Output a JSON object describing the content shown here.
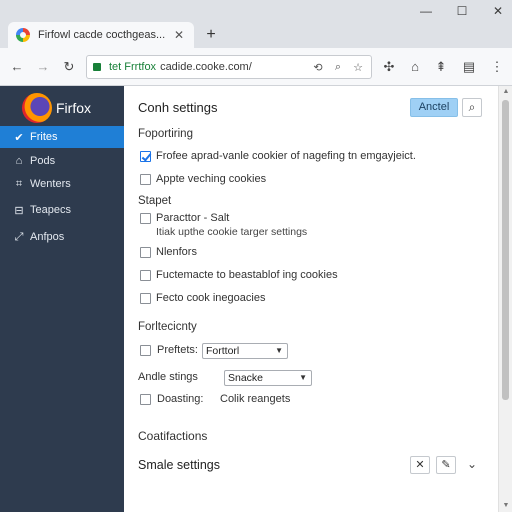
{
  "window": {
    "minimize": "—",
    "maximize": "☐",
    "close": "✕"
  },
  "tab": {
    "title": "Firfowl cacde cocthgeas...",
    "close": "✕",
    "new_tab": "+"
  },
  "toolbar": {
    "back": "←",
    "forward": "→",
    "reload": "↻",
    "url_prefix": "tet Frrtfox",
    "url": "cadide.cooke.com/",
    "url_icons": [
      "⟲",
      "⌕",
      "☆"
    ],
    "right_icons": [
      "✣",
      "⌂",
      "⇞",
      "▤",
      "⋮"
    ]
  },
  "sidebar": {
    "brand": "Firfox",
    "items": [
      {
        "label": "Frites",
        "icon": "✔",
        "active": true
      },
      {
        "label": "Pods",
        "icon": "⌂",
        "active": false
      },
      {
        "label": "Wenters",
        "icon": "⌗",
        "active": false
      },
      {
        "label": "Teapecs",
        "icon": "⊟",
        "active": false
      },
      {
        "label": "Anfpos",
        "icon": "⤢",
        "active": false
      }
    ]
  },
  "main": {
    "title": "Conh settings",
    "primary_button": "Anctel",
    "search_icon": "⌕",
    "sections": {
      "reporting": "Foportiring",
      "stapet": "Stapet",
      "fortleciany": "Forltecicnty",
      "coatifactions": "Coatifactions"
    },
    "reporting_items": [
      {
        "label": "Frofee aprad-vanle cookier of nagefing tn emgayjeict.",
        "checked": true
      },
      {
        "label": "Appte veching cookies",
        "checked": false
      }
    ],
    "stapet_items": [
      {
        "label": "Paracttor - Salt",
        "sub": "Itiak upthe cookie targer settings",
        "checked": false
      },
      {
        "label": "Nlenfors",
        "checked": false
      },
      {
        "label": "Fuctemacte to beastablof ing cookies",
        "checked": false
      },
      {
        "label": "Fecto cook inegoacies",
        "checked": false
      }
    ],
    "fortleciany_rows": {
      "row1_label": "Preftets:",
      "row1_value": "Forttorl",
      "row2_label": "Andle stings",
      "row2_value": "Snacke",
      "row3_label": "Doasting:",
      "row3_value": "Colik reangets"
    },
    "smale_settings": "Smale settings",
    "footer_icons": [
      "✕",
      "✎",
      "⌄"
    ]
  }
}
